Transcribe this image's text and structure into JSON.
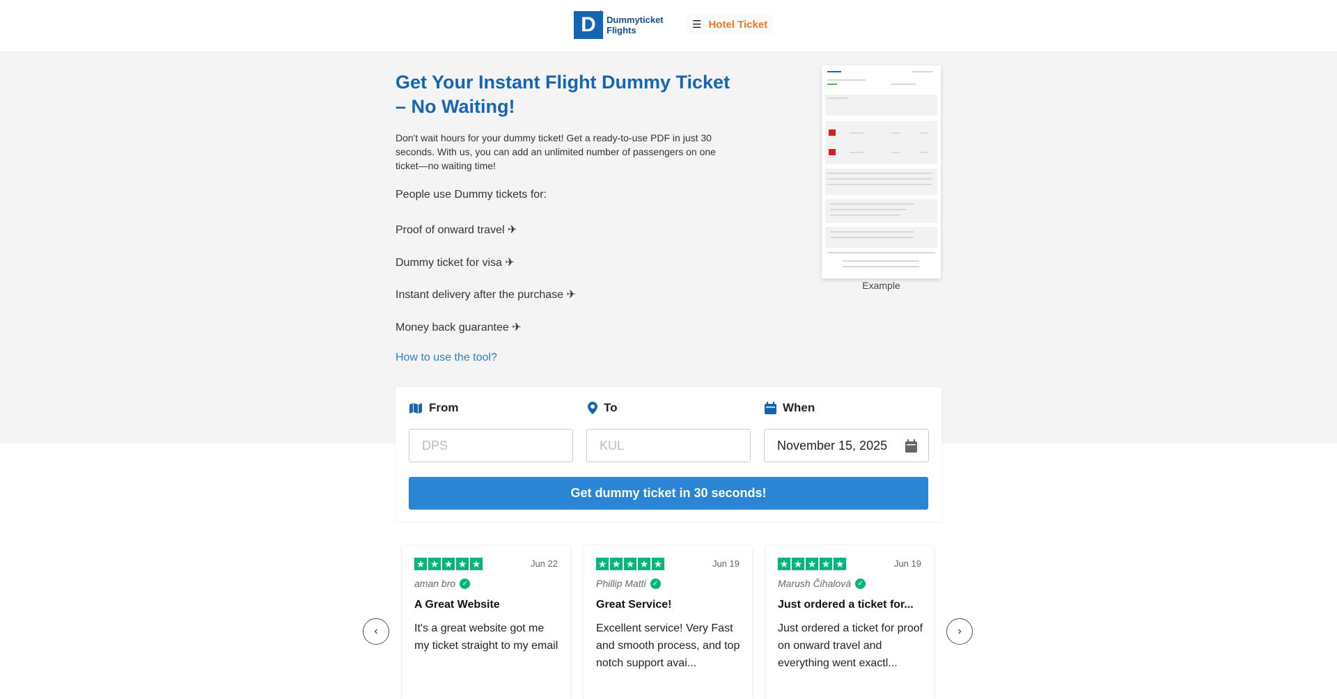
{
  "header": {
    "logo_line1": "Dummyticket",
    "logo_line2": "Flights",
    "logo_mark": "D",
    "menu_icon": "hamburger-icon",
    "hotel_link": "Hotel Ticket"
  },
  "hero": {
    "title": "Get Your Instant Flight Dummy Ticket – No Waiting!",
    "intro": "Don't wait hours for your dummy ticket! Get a ready-to-use PDF in just 30 seconds. With us, you can add an unlimited number of passengers on one ticket—no waiting time!",
    "uses_title": "People use Dummy tickets for:",
    "uses": [
      "Proof of onward travel ✈",
      "Dummy ticket for visa ✈",
      "Instant delivery after the purchase  ✈",
      "Money back guarantee  ✈"
    ],
    "how_link": "How to use the tool?",
    "example_caption": "Example"
  },
  "form": {
    "from_label": "From",
    "from_placeholder": "DPS",
    "to_label": "To",
    "to_placeholder": "KUL",
    "when_label": "When",
    "when_value": "November 15, 2025",
    "submit": "Get dummy ticket in 30 seconds!"
  },
  "reviews": [
    {
      "stars": 5,
      "date": "Jun 22",
      "author": "aman bro",
      "title": "A Great Website",
      "text": "It's a great website got me my ticket straight to my email"
    },
    {
      "stars": 5,
      "date": "Jun 19",
      "author": "Phillip Matti",
      "title": "Great Service!",
      "text": "Excellent service! Very Fast and smooth process, and top notch support avai..."
    },
    {
      "stars": 5,
      "date": "Jun 19",
      "author": "Marush Čihalová",
      "title": "Just ordered a ticket for...",
      "text": "Just ordered a ticket for proof on onward travel and everything went exactl..."
    }
  ],
  "carousel": {
    "prev": "‹",
    "next": "›"
  },
  "colors": {
    "brand_blue": "#1565b3",
    "accent_orange": "#ec7a1c",
    "button_blue": "#2a86d4",
    "trustpilot_green": "#00b67a"
  }
}
